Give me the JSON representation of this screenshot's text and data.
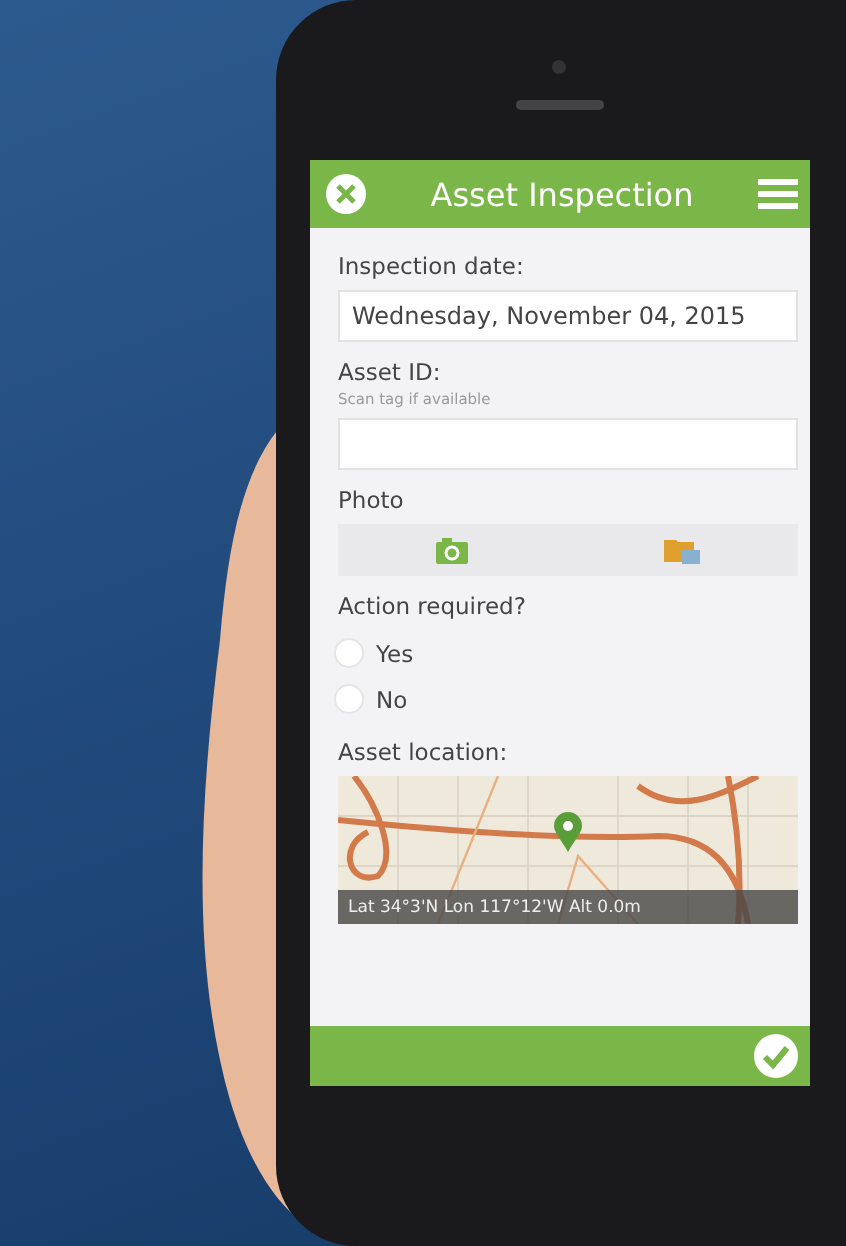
{
  "header": {
    "title": "Asset Inspection"
  },
  "fields": [
    {
      "kind": "text",
      "label": "Inspection date:",
      "value": "Wednesday, November 04, 2015"
    },
    {
      "kind": "text",
      "label": "Asset ID:",
      "hint": "Scan tag if available"
    },
    {
      "kind": "photo",
      "label": "Photo"
    },
    {
      "kind": "radio",
      "label": "Action required?",
      "options": [
        {
          "label": "Yes",
          "selected": false
        },
        {
          "label": "No",
          "selected": false
        }
      ]
    },
    {
      "kind": "map",
      "label": "Asset location:",
      "caption": "Lat 34°3'N Lon 117°12'W Alt 0.0m"
    }
  ]
}
